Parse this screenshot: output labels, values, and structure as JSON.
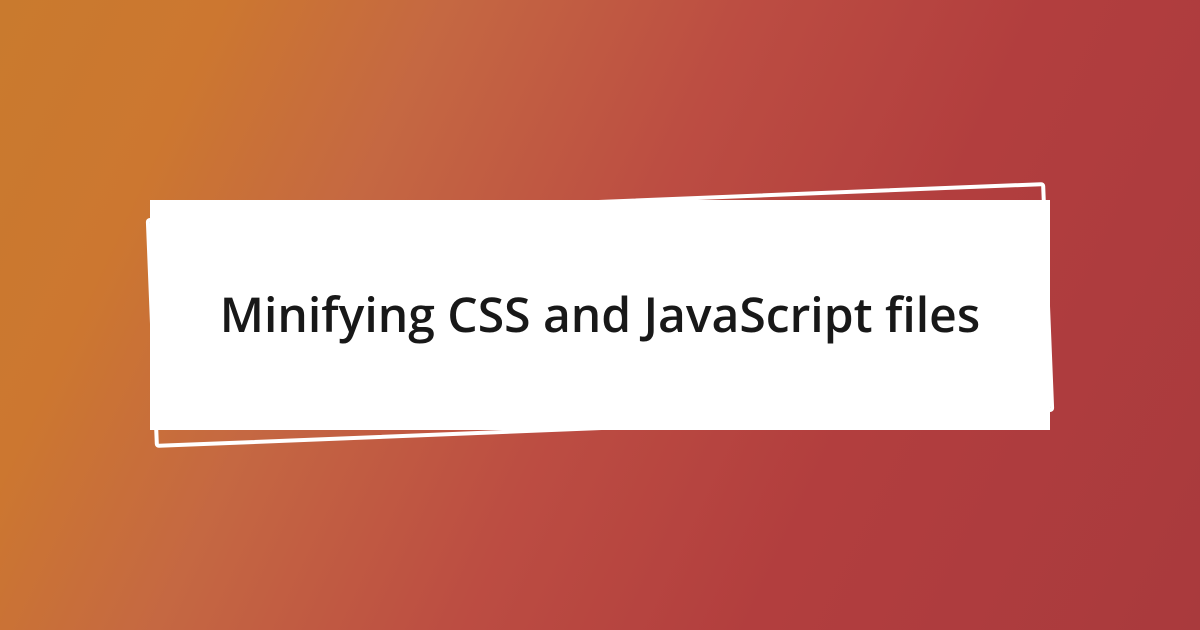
{
  "title": "Minifying CSS and JavaScript files"
}
